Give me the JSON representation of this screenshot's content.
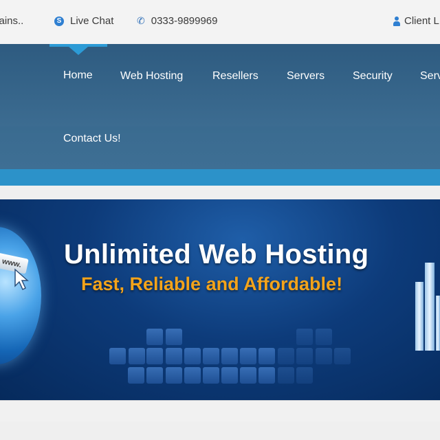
{
  "topbar": {
    "domains_label": "mains..",
    "live_chat_label": "Live Chat",
    "phone_label": "0333-9899969",
    "client_label": "Client L"
  },
  "icons": {
    "live_chat": "skype-icon",
    "phone": "phone-icon",
    "client": "user-icon"
  },
  "nav": {
    "items": [
      {
        "label": "Home",
        "active": true
      },
      {
        "label": "Web Hosting"
      },
      {
        "label": "Resellers"
      },
      {
        "label": "Servers"
      },
      {
        "label": "Security"
      },
      {
        "label": "Serv"
      },
      {
        "label": "Contact Us!"
      }
    ]
  },
  "banner": {
    "title": "Unlimited Web Hosting",
    "subtitle": "Fast, Reliable and Affordable!",
    "www_tab": "www."
  },
  "colors": {
    "nav_bg": "#35658a",
    "accent_strip": "#2c92c9",
    "banner_bg": "#0d3b7a",
    "subtitle": "#f3a31a",
    "icon_blue": "#2f7fd1"
  }
}
